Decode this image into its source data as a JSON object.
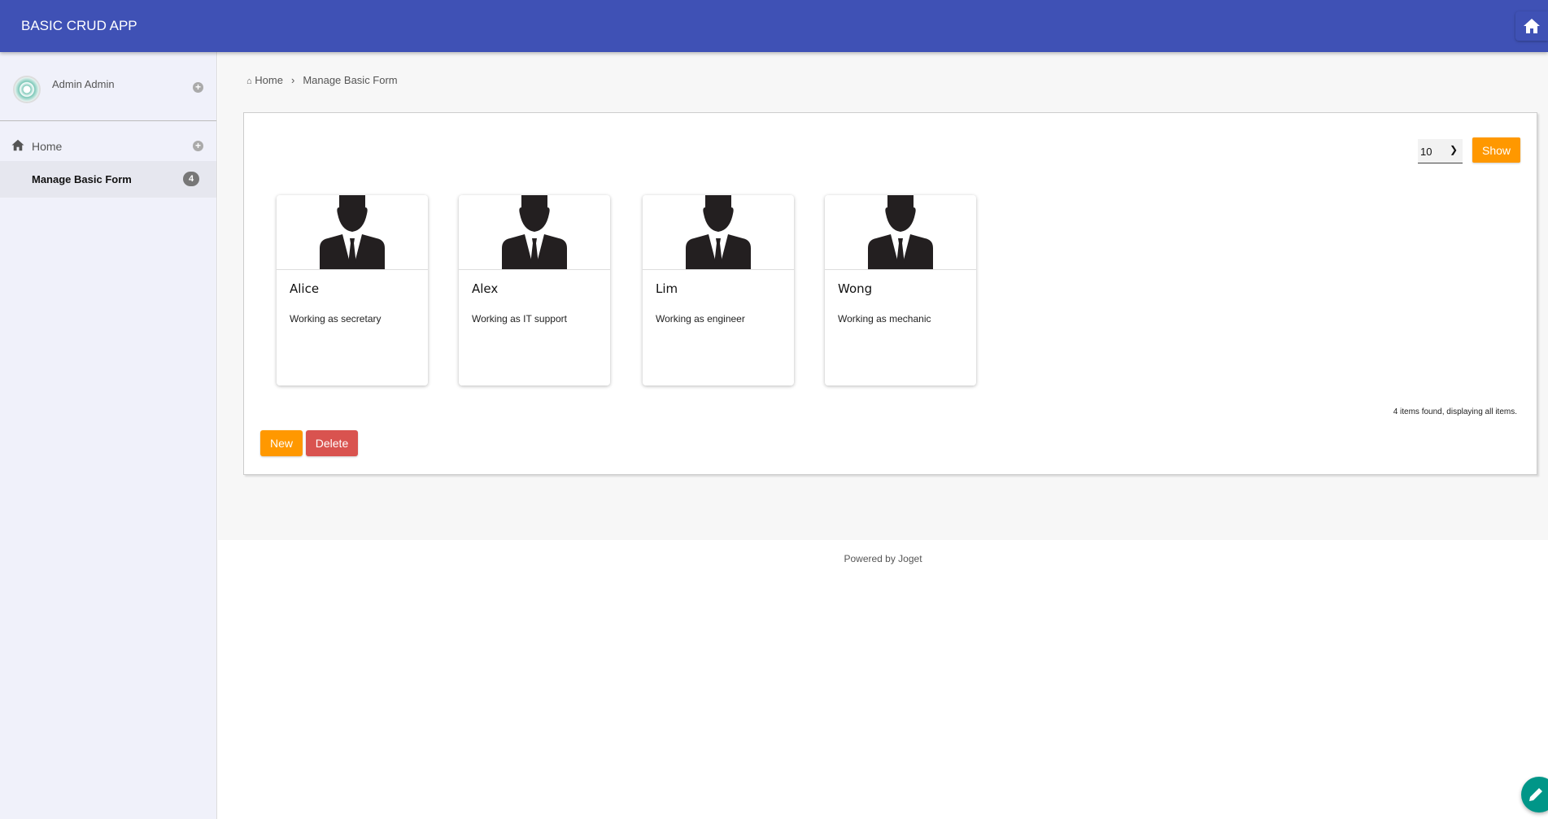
{
  "header": {
    "title": "BASIC CRUD APP"
  },
  "sidebar": {
    "user_name": "Admin Admin",
    "items": [
      {
        "label": "Home"
      },
      {
        "label": "Manage Basic Form",
        "badge": "4"
      }
    ]
  },
  "breadcrumb": {
    "home": "Home",
    "current": "Manage Basic Form"
  },
  "list": {
    "page_size": "10",
    "show_label": "Show",
    "cards": [
      {
        "name": "Alice",
        "description": "Working as secretary"
      },
      {
        "name": "Alex",
        "description": "Working as IT support"
      },
      {
        "name": "Lim",
        "description": "Working as engineer"
      },
      {
        "name": "Wong",
        "description": "Working as mechanic"
      }
    ],
    "items_found": "4 items found, displaying all items.",
    "new_label": "New",
    "delete_label": "Delete"
  },
  "footer": {
    "text": "Powered by Joget"
  },
  "colors": {
    "header": "#3f51b5",
    "accent": "#ff9800",
    "danger": "#d9534f",
    "fab": "#009688"
  }
}
